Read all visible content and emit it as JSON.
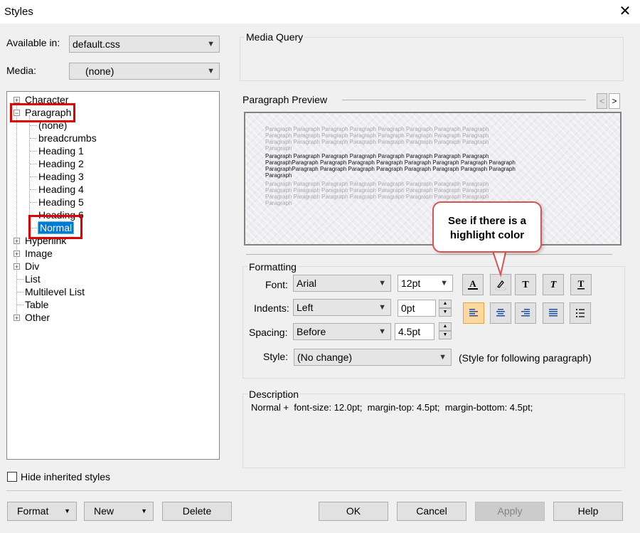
{
  "window": {
    "title": "Styles",
    "close_glyph": "✕"
  },
  "available_in": {
    "label": "Available in:",
    "value": "default.css"
  },
  "media": {
    "label": "Media:",
    "value": "(none)"
  },
  "tree": {
    "character": "Character",
    "paragraph": "Paragraph",
    "paragraph_children": [
      "(none)",
      "breadcrumbs",
      "Heading 1",
      "Heading 2",
      "Heading 3",
      "Heading 4",
      "Heading 5",
      "Heading 6",
      "Normal"
    ],
    "hyperlink": "Hyperlink",
    "image": "Image",
    "div": "Div",
    "list": "List",
    "multilevel_list": "Multilevel List",
    "table": "Table",
    "other": "Other"
  },
  "hide_inherited": {
    "label": "Hide inherited styles",
    "checked": false
  },
  "media_query": {
    "label": "Media Query"
  },
  "preview": {
    "label": "Paragraph Preview",
    "prev_glyph": "<",
    "next_glyph": ">",
    "grey_line": "Paragraph Paragraph Paragraph Paragraph Paragraph Paragraph Paragraph Paragraph",
    "grey_line_short": "Paragraph",
    "dark_line_1": "Paragraph Paragraph Paragraph Paragraph Paragraph Paragraph Paragraph Paragraph",
    "dark_line_2": "ParagraphParagraph Paragraph Paragraph Paragraph Paragraph Paragraph Paragraph Paragraph",
    "dark_line_short": "Paragraph"
  },
  "callout": {
    "text": "See if there is a highlight color",
    "border_color": "#d9534f"
  },
  "formatting": {
    "label": "Formatting",
    "font_label": "Font:",
    "font_value": "Arial",
    "size_value": "12pt",
    "indents_label": "Indents:",
    "indents_value": "Left",
    "indents_amount": "0pt",
    "spacing_label": "Spacing:",
    "spacing_value": "Before",
    "spacing_amount": "4.5pt",
    "style_label": "Style:",
    "style_value": "(No change)",
    "style_note": "(Style for following paragraph)",
    "text_tools": [
      "font-color",
      "highlight-color",
      "bold",
      "italic",
      "underline"
    ],
    "align_tools": [
      "align-left",
      "align-center",
      "align-right",
      "justify",
      "bullet-list"
    ],
    "active_align": "align-left",
    "active_color": "#fcd7a0"
  },
  "description": {
    "label": "Description",
    "text": "Normal +  font-size: 12.0pt;  margin-top: 4.5pt;  margin-bottom: 4.5pt;"
  },
  "buttons": {
    "format": "Format",
    "new": "New",
    "delete": "Delete",
    "ok": "OK",
    "cancel": "Cancel",
    "apply": "Apply",
    "help": "Help"
  },
  "highlight_color": "#e00000"
}
